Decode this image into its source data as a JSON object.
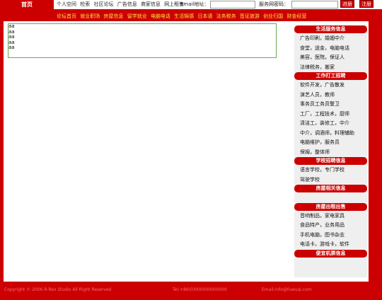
{
  "topbar": {
    "home_label": "首页",
    "links": [
      "个人空间",
      "检索",
      "社区论坛",
      "广告信息",
      "商家信息",
      "网上租售"
    ],
    "email_label": "Email地址：",
    "email_value": "",
    "password_label": "服务网密码：",
    "password_value": "",
    "register_label": "注册",
    "login_label": "进册"
  },
  "nav": {
    "items": [
      "论坛首页",
      "就业职场",
      "房屋信息",
      "留学就业",
      "电脑电话",
      "生活锦感",
      "日本语",
      "法务税务",
      "签证旅游",
      "创业归国",
      "财金经营"
    ]
  },
  "textbox": {
    "lines": [
      "aa",
      "aa",
      "aa",
      "aa",
      "aa"
    ]
  },
  "sidebar": {
    "sections": [
      {
        "title": "生活服务信息",
        "items": [
          "广告印刷，婚姻中介",
          "食堂，送金，电脑电话",
          "美容，医院，保证人",
          "法律税务，搬家"
        ]
      },
      {
        "title": "工作打工招聘",
        "items": [
          "软件开发，广告散发",
          "演艺人员，教师",
          "事务员工务员警卫",
          "工厂，工程技术，厨师",
          "清洁工，装修工，中介",
          "中介，调酒师，料理辅助",
          "电脑维护，服务员",
          "保姆，整体师"
        ]
      },
      {
        "title": "学校招聘信息",
        "items": [
          "语言学校，专门学校",
          "驾驶学校"
        ]
      },
      {
        "title": "房屋相关信息",
        "items": [
          ""
        ]
      },
      {
        "title": "房屋出租出售",
        "items": [
          "音响制品，家电家具",
          "食品特产，业务用品",
          "手机电脑，图书杂志",
          "电话卡，游戏卡，软件"
        ]
      },
      {
        "title": "便宜机票信息",
        "items": []
      }
    ]
  },
  "footer": {
    "copyright": "Copyright © 2006 R-Rex Studio All Right Reserved",
    "tel": "Tel:+86(0)000000000000",
    "email": "Email:info@fuwuqi.com"
  }
}
